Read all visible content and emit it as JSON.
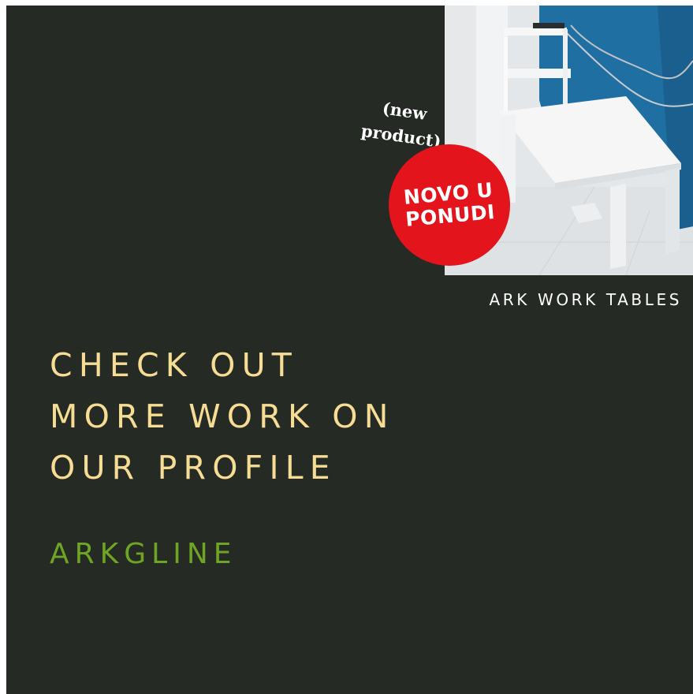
{
  "photo": {
    "subject": "white work table with shelves against blue wall"
  },
  "note": {
    "line1": "(new",
    "line2": "product)"
  },
  "badge": {
    "line1": "NOVO U",
    "line2": "PONUDI",
    "color": "#e3141c"
  },
  "caption": "ARK WORK TABLES",
  "headline": {
    "line1": "CHECK OUT",
    "line2": "MORE WORK ON",
    "line3": "OUR PROFILE"
  },
  "brand": "ARKGLINE",
  "colors": {
    "background": "#262a25",
    "headline": "#f6dd93",
    "brand": "#6fa524",
    "caption": "#ffffff"
  }
}
